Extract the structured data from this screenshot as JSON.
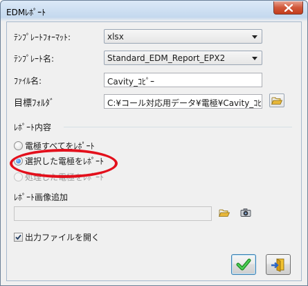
{
  "window": {
    "title": "EDMﾚﾎﾟｰﾄ"
  },
  "template_format": {
    "label": "ﾃﾝﾌﾟﾚｰﾄﾌｫｰﾏｯﾄ:",
    "value": "xlsx"
  },
  "template_name": {
    "label": "ﾃﾝﾌﾟﾚｰﾄ名:",
    "value": "Standard_EDM_Report_EPX2"
  },
  "file_name": {
    "label": "ﾌｧｲﾙ名:",
    "value": "Cavity_ｺﾋﾟｰ"
  },
  "target_folder": {
    "label": "目標ﾌｫﾙﾀﾞ",
    "value": "C:¥コール対応用データ¥電極¥Cavity_ｺﾋﾟｰ"
  },
  "report_content": {
    "label": "ﾚﾎﾟｰﾄ内容",
    "options": [
      {
        "label": "電極すべてをﾚﾎﾟｰﾄ",
        "selected": false,
        "enabled": true
      },
      {
        "label": "選択した電極をﾚﾎﾟｰﾄ",
        "selected": true,
        "enabled": true
      },
      {
        "label": "処理した電極をﾚﾎﾟｰﾄ",
        "selected": false,
        "enabled": false
      }
    ]
  },
  "report_image": {
    "label": "ﾚﾎﾟｰﾄ画像追加",
    "value": ""
  },
  "open_output": {
    "label": "出力ファイルを開く",
    "checked": true
  },
  "icons": {
    "close": "close-icon",
    "browse_folder": "folder-open-icon",
    "browse_image": "folder-open-icon",
    "camera": "camera-icon",
    "ok": "checkmark-icon",
    "cancel": "exit-icon"
  },
  "colors": {
    "annotation": "#e3101c",
    "ok_check": "#1ea12a",
    "folder": "#d9a520",
    "radio_dot": "#1a6ad0"
  }
}
